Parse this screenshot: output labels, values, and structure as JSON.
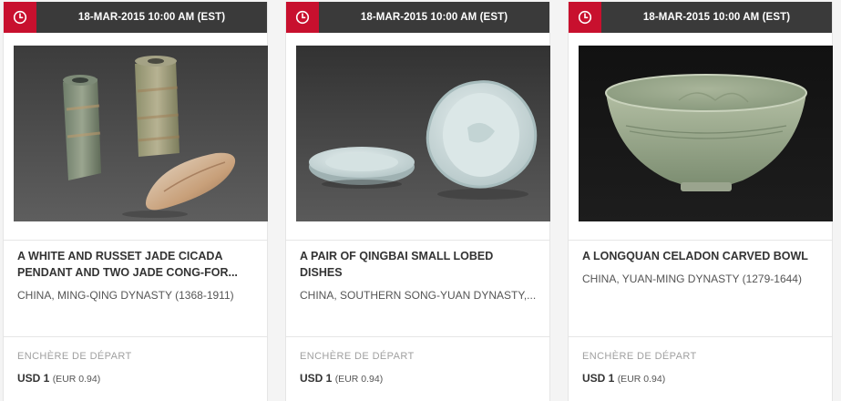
{
  "lots": [
    {
      "date": "18-MAR-2015 10:00 AM (EST)",
      "title": "A WHITE AND RUSSET JADE CICADA PENDANT AND TWO JADE CONG-FOR...",
      "subtitle": "CHINA, MING-QING DYNASTY (1368-1911)",
      "start_label": "ENCHÈRE DE DÉPART",
      "price_usd": "USD 1",
      "price_eur": "(EUR 0.94)"
    },
    {
      "date": "18-MAR-2015 10:00 AM (EST)",
      "title": "A PAIR OF QINGBAI SMALL LOBED DISHES",
      "subtitle": "CHINA, SOUTHERN SONG-YUAN DYNASTY,...",
      "start_label": "ENCHÈRE DE DÉPART",
      "price_usd": "USD 1",
      "price_eur": "(EUR 0.94)"
    },
    {
      "date": "18-MAR-2015 10:00 AM (EST)",
      "title": "A LONGQUAN CELADON CARVED BOWL",
      "subtitle": "CHINA, YUAN-MING DYNASTY (1279-1644)",
      "start_label": "ENCHÈRE DE DÉPART",
      "price_usd": "USD 1",
      "price_eur": "(EUR 0.94)"
    }
  ],
  "icons": {
    "clock": "clock-icon"
  },
  "colors": {
    "accent": "#c8102e",
    "topbar": "#3a3a3a",
    "text": "#333333",
    "muted": "#a0a0a0"
  }
}
